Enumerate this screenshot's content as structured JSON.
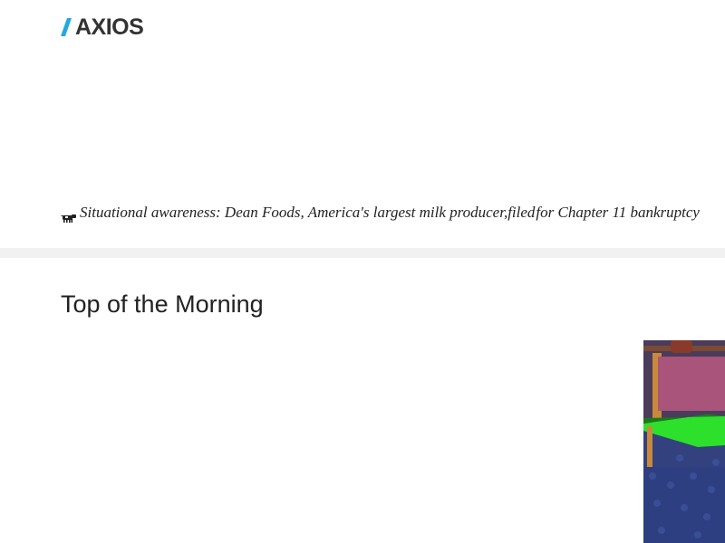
{
  "header": {
    "logo": {
      "text": "AXIOS",
      "icon": "axios-logo-mark",
      "colors": {
        "mark": "#22a9de",
        "text": "#333333"
      }
    }
  },
  "situational_awareness": {
    "icon": "cow-icon",
    "text_before": "Situational awareness: Dean Foods, America's largest milk producer, ",
    "link_text": "filed",
    "text_after": " for Chapter 11 bankruptcy",
    "link_underline_color": "#2f6fb0"
  },
  "section": {
    "title": "Top of the Morning"
  },
  "story": {
    "image_description": "cartoon-gif-image"
  },
  "colors": {
    "divider": "#f1f1f1",
    "text": "#222222"
  }
}
